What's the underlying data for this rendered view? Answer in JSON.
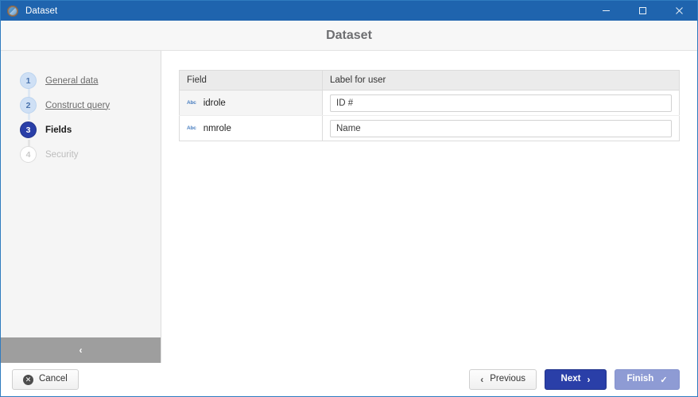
{
  "window": {
    "titlebar": {
      "icon": "dataset-globe-icon",
      "title": "Dataset",
      "minimize_label": "—",
      "maximize_label": "□",
      "close_label": "✕"
    },
    "header": {
      "title": "Dataset"
    }
  },
  "sidebar": {
    "steps": [
      {
        "number": "1",
        "label": "General data",
        "state": "done"
      },
      {
        "number": "2",
        "label": "Construct query",
        "state": "done"
      },
      {
        "number": "3",
        "label": "Fields",
        "state": "active"
      },
      {
        "number": "4",
        "label": "Security",
        "state": "disabled"
      }
    ],
    "collapse_icon": "‹"
  },
  "main": {
    "table": {
      "columns": [
        "Field",
        "Label for user"
      ],
      "rows": [
        {
          "type_icon": "Abc",
          "field": "idrole",
          "label_value": "ID #"
        },
        {
          "type_icon": "Abc",
          "field": "nmrole",
          "label_value": "Name"
        }
      ]
    }
  },
  "footer": {
    "cancel": {
      "icon": "✕",
      "label": "Cancel"
    },
    "previous": {
      "icon": "‹",
      "label": "Previous"
    },
    "next": {
      "label": "Next",
      "icon": "›"
    },
    "finish": {
      "label": "Finish",
      "icon": "✓"
    }
  },
  "colors": {
    "titlebar": "#1f64ae",
    "accent": "#2a3fa8",
    "step_done": "#cfe0f5",
    "finish": "#8e9bd4",
    "sidebar_bg": "#f5f5f5",
    "header_bg": "#f7f7f7"
  }
}
